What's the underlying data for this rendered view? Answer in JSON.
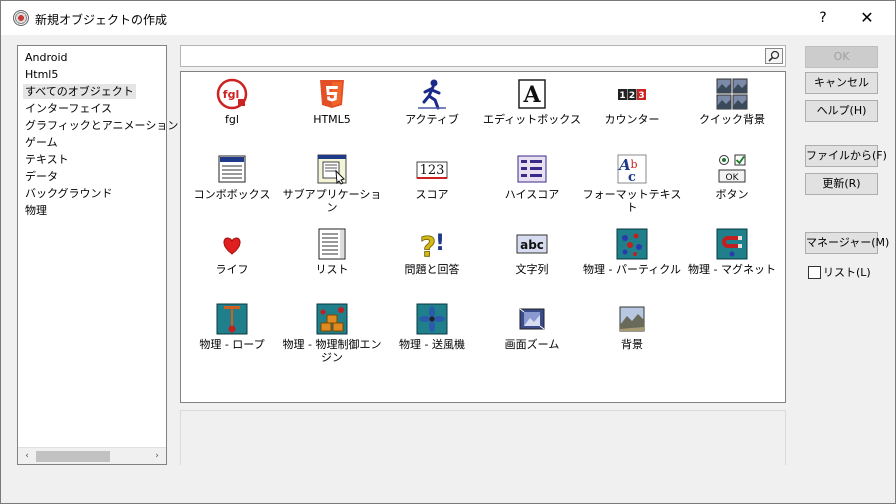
{
  "window": {
    "title": "新規オブジェクトの作成",
    "help_label": "?",
    "close_label": "✕"
  },
  "categories": [
    {
      "label": "Android"
    },
    {
      "label": "Html5"
    },
    {
      "label": "すべてのオブジェクト",
      "selected": true
    },
    {
      "label": "インターフェイス"
    },
    {
      "label": "グラフィックとアニメーション"
    },
    {
      "label": "ゲーム"
    },
    {
      "label": "テキスト"
    },
    {
      "label": "データ"
    },
    {
      "label": "バックグラウンド"
    },
    {
      "label": "物理"
    }
  ],
  "scrollbar": {
    "left_arrow": "‹",
    "right_arrow": "›"
  },
  "search": {
    "value": "",
    "placeholder": ""
  },
  "objects": [
    {
      "label": "fgl",
      "icon": "fgl-icon"
    },
    {
      "label": "HTML5",
      "icon": "html5-icon"
    },
    {
      "label": "アクティブ",
      "icon": "active-runner-icon"
    },
    {
      "label": "エディットボックス",
      "icon": "edit-box-icon",
      "glyph": "A"
    },
    {
      "label": "カウンター",
      "icon": "counter-icon",
      "glyph": "123"
    },
    {
      "label": "クイック背景",
      "icon": "quick-background-icon"
    },
    {
      "label": "コンボボックス",
      "icon": "combo-box-icon"
    },
    {
      "label": "サブアプリケーション",
      "icon": "sub-application-icon"
    },
    {
      "label": "スコア",
      "icon": "score-icon",
      "glyph": "123"
    },
    {
      "label": "ハイスコア",
      "icon": "hi-score-icon"
    },
    {
      "label": "フォーマットテキスト",
      "icon": "formatted-text-icon",
      "glyph": "Abc"
    },
    {
      "label": "ボタン",
      "icon": "button-icon",
      "glyph": "OK"
    },
    {
      "label": "ライフ",
      "icon": "lives-heart-icon"
    },
    {
      "label": "リスト",
      "icon": "list-icon"
    },
    {
      "label": "問題と回答",
      "icon": "question-answer-icon",
      "glyph": "?!"
    },
    {
      "label": "文字列",
      "icon": "string-icon",
      "glyph": "abc"
    },
    {
      "label": "物理 - パーティクル",
      "icon": "physics-particle-icon"
    },
    {
      "label": "物理 - マグネット",
      "icon": "physics-magnet-icon"
    },
    {
      "label": "物理 - ロープ",
      "icon": "physics-rope-icon"
    },
    {
      "label": "物理 - 物理制御エンジン",
      "icon": "physics-engine-icon"
    },
    {
      "label": "物理 - 送風機",
      "icon": "physics-fan-icon"
    },
    {
      "label": "画面ズーム",
      "icon": "screen-zoom-icon"
    },
    {
      "label": "背景",
      "icon": "background-icon"
    }
  ],
  "buttons": {
    "ok": "OK",
    "cancel": "キャンセル",
    "help": "ヘルプ(H)",
    "from_file": "ファイルから(F)",
    "refresh": "更新(R)",
    "manager": "マネージャー(M)"
  },
  "list_checkbox": {
    "label": "リスト(L)",
    "checked": false
  },
  "colors": {
    "accent_red": "#cc2222",
    "html5_orange": "#e34f26",
    "physics_teal": "#1f7f8a"
  }
}
